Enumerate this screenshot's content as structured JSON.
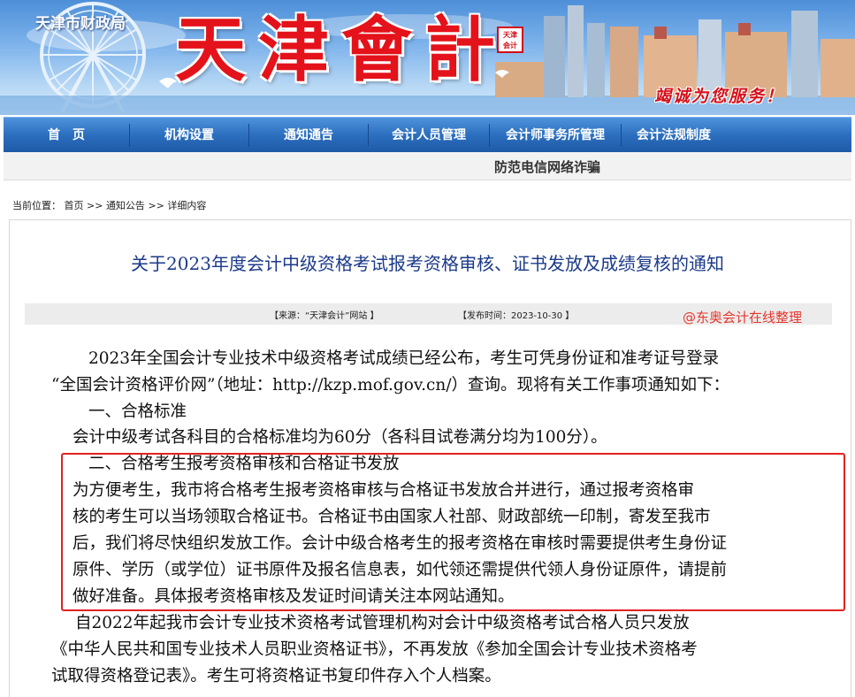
{
  "header": {
    "bureau": "天津市财政局",
    "site_title": "天津會計",
    "seal_text": "天津 会计",
    "slogan": "竭诚为您服务！"
  },
  "nav": {
    "items": [
      "首　页",
      "机构设置",
      "通知通告",
      "会计人员管理",
      "会计师事务所管理",
      "会计法规制度"
    ]
  },
  "fraud_notice": "防范电信网络诈骗",
  "breadcrumb": {
    "label": "当前位置：",
    "home": "首页",
    "sep": ">>",
    "notices": "通知公告",
    "current": "详细内容"
  },
  "article": {
    "title": "关于2023年度会计中级资格考试报考资格审核、证书发放及成绩复核的通知",
    "source": "【来源：“天津会计”网站 】",
    "date": "【发布时间：2023-10-30 】",
    "watermark": "@东奥会计在线整理",
    "lines": [
      "2023年全国会计专业技术中级资格考试成绩已经公布，考生可凭身份证和准考证号登录",
      "“全国会计资格评价网”（地址：http://kzp.mof.gov.cn/）查询。现将有关工作事项通知如下：",
      "一、合格标准",
      "会计中级考试各科目的合格标准均为60分（各科目试卷满分均为100分）。",
      "二、合格考生报考资格审核和合格证书发放",
      "为方便考生，我市将合格考生报考资格审核与合格证书发放合并进行，通过报考资格审",
      "核的考生可以当场领取合格证书。合格证书由国家人社部、财政部统一印制，寄发至我市",
      "后，我们将尽快组织发放工作。会计中级合格考生的报考资格在审核时需要提供考生身份证",
      "原件、学历（或学位）证书原件及报名信息表，如代领还需提供代领人身份证原件，请提前",
      "做好准备。具体报考资格审核及发证时间请关注本网站通知。",
      "自2022年起我市会计专业技术资格考试管理机构对会计中级资格考试合格人员只发放",
      "《中华人民共和国专业技术人员职业资格证书》，不再发放《参加全国会计专业技术资格考",
      "试取得资格登记表》。考生可将资格证书复印件存入个人档案。"
    ]
  },
  "colors": {
    "nav_blue": "#2c6fbf",
    "title_blue": "#1b3a8a",
    "brand_red": "#e4121a",
    "highlight_red": "#e0231d"
  }
}
